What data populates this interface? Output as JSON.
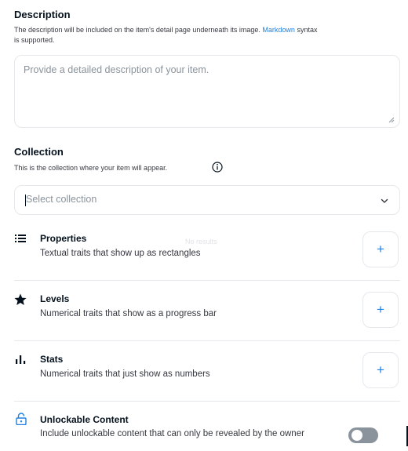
{
  "description": {
    "title": "Description",
    "help_text": "The description will be included on the item's detail page underneath its image.",
    "link_text": "Markdown",
    "help_text_after": "syntax",
    "help_text_line2": "is supported.",
    "placeholder": "Provide a detailed description of your item."
  },
  "collection": {
    "title": "Collection",
    "help_text": "This is the collection where your item will appear.",
    "select_placeholder": "Select collection",
    "dropdown_hint": "No results"
  },
  "traits": [
    {
      "title": "Properties",
      "subtitle": "Textual traits that show up as rectangles",
      "icon": "list-icon"
    },
    {
      "title": "Levels",
      "subtitle": "Numerical traits that show as a progress bar",
      "icon": "star-icon"
    },
    {
      "title": "Stats",
      "subtitle": "Numerical traits that just show as numbers",
      "icon": "bar-chart-icon"
    }
  ],
  "add_label": "+",
  "unlockable": {
    "title": "Unlockable Content",
    "subtitle": "Include unlockable content that can only be revealed by the owner",
    "enabled": false
  },
  "colors": {
    "accent": "#2081e2",
    "text": "#04111d",
    "muted": "#8a939b",
    "border": "#e5e8eb"
  }
}
